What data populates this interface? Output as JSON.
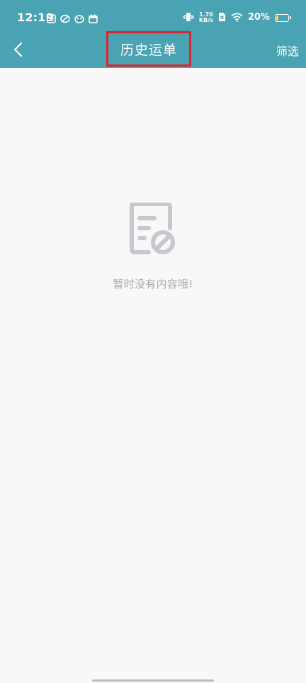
{
  "status_bar": {
    "time": "12:19",
    "net_speed_value": "1.70",
    "net_speed_unit": "KB/s",
    "battery_percent": "20%",
    "battery_level": 0.2,
    "left_icons": [
      "album-icon",
      "leaf-icon",
      "mask-icon",
      "calendar-icon"
    ],
    "right_icons": [
      "vibrate-icon",
      "sim-blocked-icon",
      "wifi-icon",
      "battery-icon"
    ]
  },
  "header": {
    "title": "历史运单",
    "filter_label": "筛选",
    "back_icon": "chevron-left-icon",
    "background_color": "#4aa3b2",
    "highlight_color": "#e1222e"
  },
  "empty_state": {
    "icon": "empty-document-icon",
    "message": "暂时没有内容哦!"
  }
}
